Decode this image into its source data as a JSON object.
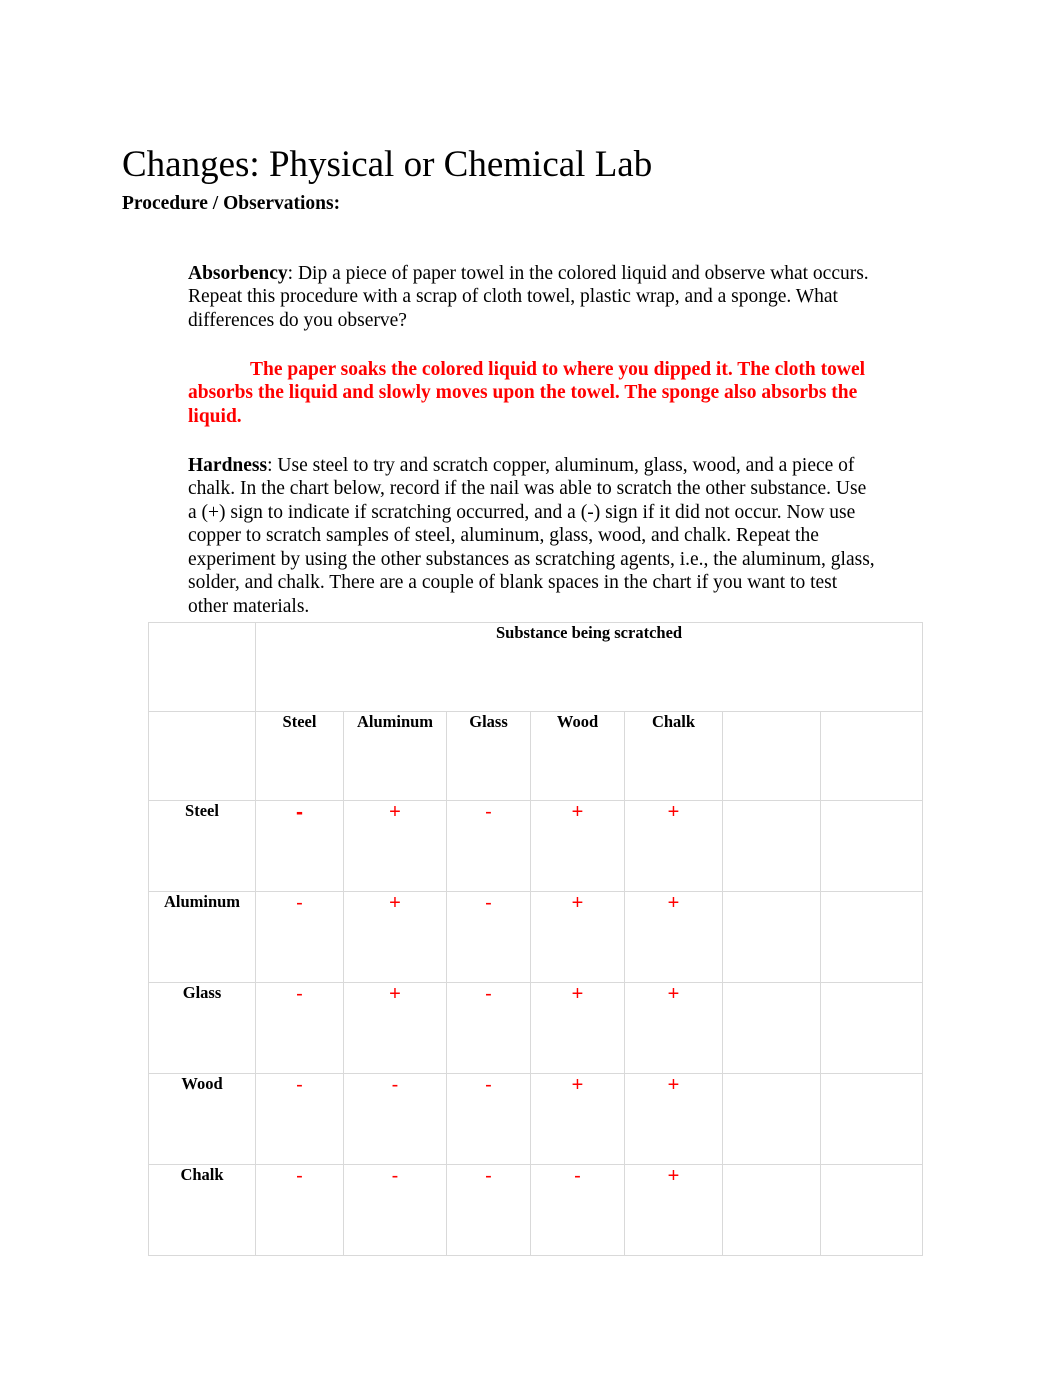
{
  "document": {
    "title": "Changes: Physical or Chemical Lab",
    "section_heading": "Procedure / Observations:"
  },
  "paragraphs": {
    "absorbency_label": "Absorbency",
    "absorbency_text": ": Dip a piece of paper towel in the colored liquid and observe what occurs. Repeat this procedure with a scrap of cloth towel, plastic wrap, and a sponge. What differences do you observe?",
    "absorbency_answer": "The paper soaks the colored liquid to where you dipped it. The cloth towel absorbs the liquid and slowly moves upon the towel. The sponge also absorbs the liquid.",
    "hardness_label": "Hardness",
    "hardness_text": ": Use steel to try and scratch copper, aluminum, glass, wood, and a piece of chalk.  In the chart below, record if the nail was able to scratch the other substance.   Use a (+) sign to indicate if scratching occurred, and a (-) sign if it did not occur. Now use copper to scratch samples of steel, aluminum, glass, wood, and chalk. Repeat the experiment by using the other substances as scratching agents, i.e., the aluminum, glass, solder, and chalk. There are a couple of blank spaces in the chart if you want to test other materials."
  },
  "colors": {
    "answer_red": "#FF0000",
    "mark_red": "#FF0000",
    "table_border": "#D9D9D9",
    "text": "#000000"
  },
  "chart_data": {
    "type": "table",
    "title": "Substance being scratched",
    "corner_label": "",
    "column_headers": [
      "Steel",
      "Aluminum",
      "Glass",
      "Wood",
      "Chalk",
      "",
      ""
    ],
    "row_headers": [
      "Steel",
      "Aluminum",
      "Glass",
      "Wood",
      "Chalk"
    ],
    "rows": [
      {
        "label": "Steel",
        "values": [
          "-",
          "+",
          "-",
          "+",
          "+",
          "",
          ""
        ]
      },
      {
        "label": "Aluminum",
        "values": [
          "-",
          "+",
          "-",
          "+",
          "+",
          "",
          ""
        ]
      },
      {
        "label": "Glass",
        "values": [
          "-",
          "+",
          "-",
          "+",
          "+",
          "",
          ""
        ]
      },
      {
        "label": "Wood",
        "values": [
          "-",
          "-",
          "-",
          "+",
          "+",
          "",
          ""
        ]
      },
      {
        "label": "Chalk",
        "values": [
          "-",
          "-",
          "-",
          "-",
          "+",
          "",
          ""
        ]
      }
    ]
  }
}
